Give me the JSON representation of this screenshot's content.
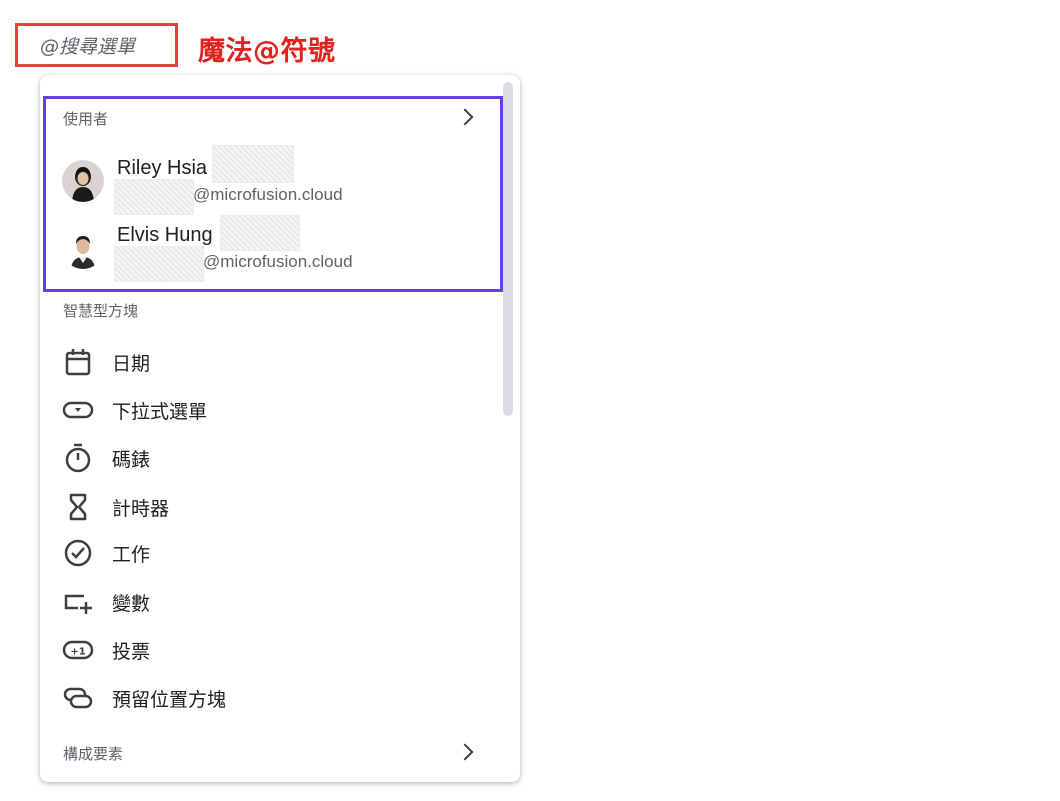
{
  "search": {
    "text": "@搜尋選單"
  },
  "callout": {
    "text": "魔法@符號",
    "color": "#e0231f"
  },
  "menu": {
    "users_section": {
      "title": "使用者",
      "users": [
        {
          "name": "Riley Hsia",
          "email": "@microfusion.cloud"
        },
        {
          "name": "Elvis Hung",
          "email": "@microfusion.cloud"
        }
      ]
    },
    "smart_chips_section": {
      "title": "智慧型方塊",
      "items": [
        {
          "label": "日期",
          "icon": "calendar-icon"
        },
        {
          "label": "下拉式選單",
          "icon": "dropdown-icon"
        },
        {
          "label": "碼錶",
          "icon": "stopwatch-icon"
        },
        {
          "label": "計時器",
          "icon": "hourglass-icon"
        },
        {
          "label": "工作",
          "icon": "task-check-icon"
        },
        {
          "label": "變數",
          "icon": "variable-icon"
        },
        {
          "label": "投票",
          "icon": "vote-icon"
        },
        {
          "label": "預留位置方塊",
          "icon": "placeholder-chip-icon"
        }
      ]
    },
    "building_blocks_section": {
      "title": "構成要素"
    }
  },
  "colors": {
    "highlight_users": "#6a3df0",
    "search_border": "#e0453a"
  }
}
